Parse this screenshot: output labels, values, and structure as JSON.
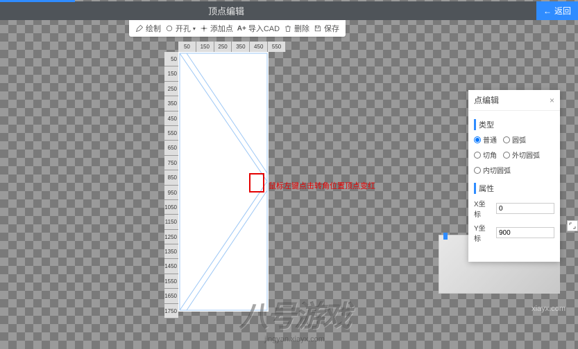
{
  "progress": {
    "percent": 13
  },
  "header": {
    "title": "顶点编辑",
    "back_label": "返回"
  },
  "toolbar": {
    "items": [
      {
        "label": "绘制"
      },
      {
        "label": "开孔"
      },
      {
        "label": "添加点"
      },
      {
        "label": "导入CAD"
      },
      {
        "label": "删除"
      },
      {
        "label": "保存"
      }
    ]
  },
  "ruler": {
    "h": [
      "50",
      "150",
      "250",
      "350",
      "450",
      "550"
    ],
    "v": [
      "50",
      "150",
      "250",
      "350",
      "450",
      "550",
      "650",
      "750",
      "850",
      "950",
      "1050",
      "1150",
      "1250",
      "1350",
      "1450",
      "1550",
      "1650",
      "1750"
    ]
  },
  "annotation": {
    "text": "鼠标左键点击转角位置顶点变红"
  },
  "panel": {
    "title": "点编辑",
    "section_type": "类型",
    "radios": [
      {
        "label": "普通",
        "checked": true
      },
      {
        "label": "圆弧",
        "checked": false
      },
      {
        "label": "切角",
        "checked": false
      }
    ],
    "radios2": [
      {
        "label": "外切圆弧",
        "checked": false
      },
      {
        "label": "内切圆弧",
        "checked": false
      }
    ],
    "section_attr": "属性",
    "fields": [
      {
        "label": "X坐标",
        "value": "0"
      },
      {
        "label": "Y坐标",
        "value": "900"
      }
    ]
  },
  "watermark": {
    "brand": "八号游戏",
    "pinyin": "jingyan.xiayx.com",
    "url": "xiayx.com"
  }
}
